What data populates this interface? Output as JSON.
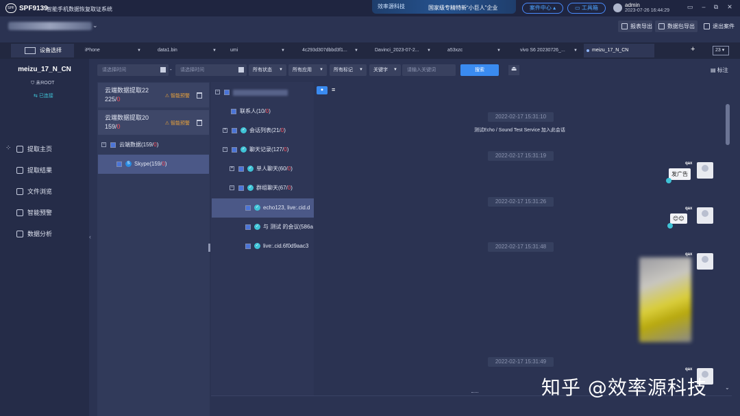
{
  "app": {
    "name": "SPF9139",
    "subtitle": "智能手机数据恢复取证系统",
    "banner_logo": "效率源科技",
    "banner_text": "国家级专精特新“小巨人”企业",
    "case_center": "案件中心",
    "toolbox": "工具箱"
  },
  "user": {
    "name": "admin",
    "time": "2023-07-26 16:44:29"
  },
  "toolbar": {
    "report_export": "报表导出",
    "data_export": "数据包导出",
    "exit_case": "退出案件"
  },
  "tabs": {
    "device_select": "设备选择",
    "items": [
      "iPhone",
      "data1.bin",
      "umi",
      "4c293d307dbbd3f1...",
      "Davinci_2023-07-2...",
      "a53xzc",
      "vivo S6 20230726_...",
      "meizu_17_N_CN"
    ],
    "add": "+",
    "count": "23"
  },
  "device": {
    "name": "meizu_17_N_CN",
    "root": "未ROOT",
    "status": "已连接"
  },
  "nav": [
    "提取主页",
    "提取结果",
    "文件浏览",
    "智能预警",
    "数据分析"
  ],
  "filter": {
    "start_placeholder": "请选择时间",
    "end_placeholder": "请选择时间",
    "sep": "-",
    "status": "所有状态",
    "app": "所有应用",
    "tag": "所有标记",
    "keyword": "关键字",
    "keyword_placeholder": "请输入关键词",
    "search": "搜索",
    "tag_label": "标注"
  },
  "cards": [
    {
      "title": "云端数据提取22",
      "count": "225/",
      "red": "0",
      "warn": "智能预警"
    },
    {
      "title": "云端数据提取20",
      "count": "159/",
      "red": "0",
      "warn": "智能预警"
    }
  ],
  "cloud": {
    "label": "云端数据(159/",
    "red": "0",
    "close": ")"
  },
  "skype": {
    "label": "Skype(159/",
    "red": "0",
    "close": ")"
  },
  "tree": [
    {
      "label": "联系人(10/",
      "red": "0"
    },
    {
      "label": "会话列表(21/",
      "red": "0"
    },
    {
      "label": "聊天记录(127/",
      "red": "0"
    },
    {
      "label": "单人聊天(60/",
      "red": "0"
    },
    {
      "label": "群组聊天(67/",
      "red": "0"
    }
  ],
  "threads": [
    "echo123, live:.cid.d",
    "与 测试 的会议(586a",
    "live:.cid.6f0d9aac3"
  ],
  "chat": {
    "stamps": [
      "2022-02-17 15:31:10",
      "2022-02-17 15:31:19",
      "2022-02-17 15:31:26",
      "2022-02-17 15:31:48",
      "2022-02-17 15:31:49"
    ],
    "system_msg": "测试Echo / Sound Test Service 加入此会话",
    "sender": "qax",
    "msg1": "发广告",
    "msg2": "😊😊"
  },
  "watermark": "知乎 @效率源科技"
}
